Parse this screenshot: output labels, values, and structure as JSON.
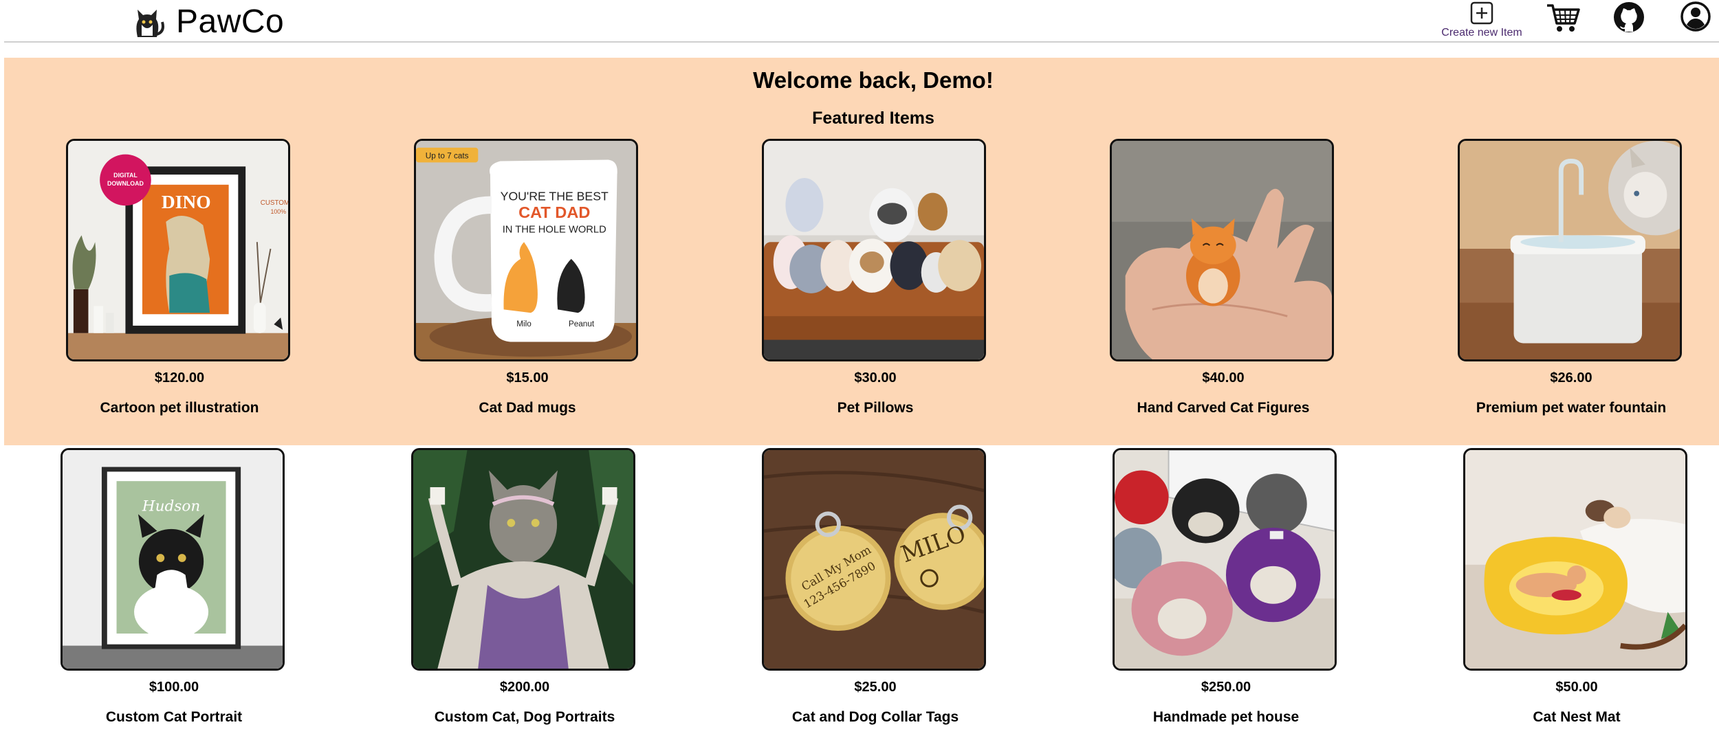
{
  "header": {
    "brand": "PawCo",
    "logo_icon": "cat-logo-icon",
    "create_label": "Create new Item",
    "icons": [
      "plus-square-icon",
      "cart-icon",
      "github-icon",
      "user-icon"
    ]
  },
  "featured": {
    "welcome": "Welcome back, Demo!",
    "title": "Featured Items",
    "background": "#fdd7b6",
    "items": [
      {
        "price": "$120.00",
        "name": "Cartoon pet illustration",
        "badge": "DIGITAL DOWNLOAD",
        "poster_text": "DINO",
        "side_text": "CUSTOM 100%"
      },
      {
        "price": "$15.00",
        "name": "Cat Dad mugs",
        "tag": "Up to 7 cats",
        "mug_line1": "YOU'RE THE BEST",
        "mug_line2": "CAT DAD",
        "mug_line3": "IN THE HOLE WORLD",
        "cat_name_1": "Milo",
        "cat_name_2": "Peanut"
      },
      {
        "price": "$30.00",
        "name": "Pet Pillows"
      },
      {
        "price": "$40.00",
        "name": "Hand Carved Cat Figures"
      },
      {
        "price": "$26.00",
        "name": "Premium pet water fountain"
      }
    ]
  },
  "items": [
    {
      "price": "$100.00",
      "name": "Custom Cat Portrait",
      "poster_text": "Hudson"
    },
    {
      "price": "$200.00",
      "name": "Custom Cat, Dog Portraits"
    },
    {
      "price": "$25.00",
      "name": "Cat and Dog Collar Tags",
      "tag_text_1": "Call My Mom",
      "tag_text_2": "123-456-7890",
      "tag_text_3": "MILO"
    },
    {
      "price": "$250.00",
      "name": "Handmade pet house"
    },
    {
      "price": "$50.00",
      "name": "Cat Nest Mat"
    }
  ]
}
